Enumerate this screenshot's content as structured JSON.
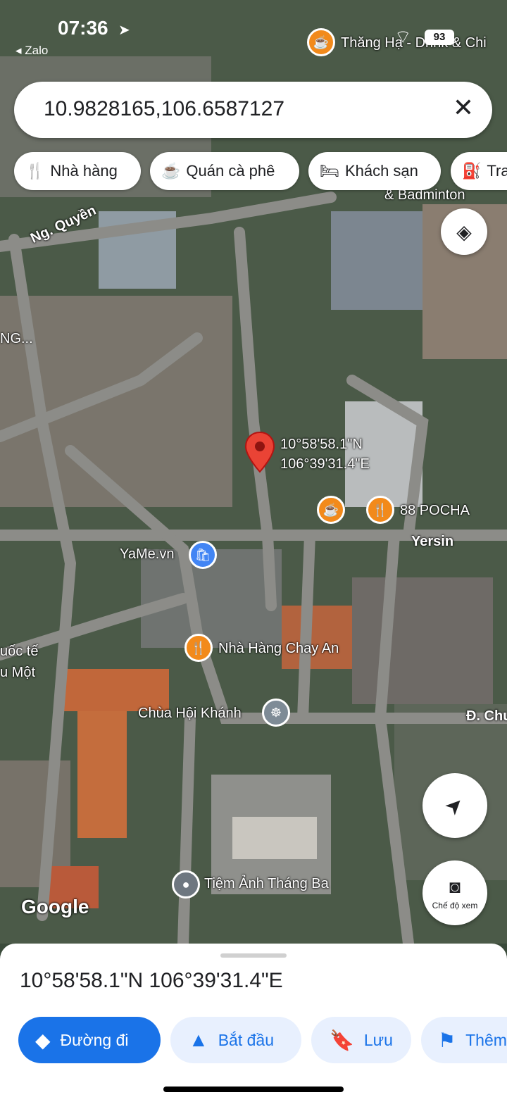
{
  "status_bar": {
    "time": "07:36",
    "back_app": "◂ Zalo",
    "battery": "93"
  },
  "search": {
    "query": "10.9828165,106.6587127"
  },
  "chips": [
    {
      "label": "Nhà hàng",
      "icon": "fork-knife-icon"
    },
    {
      "label": "Quán cà phê",
      "icon": "coffee-cup-icon"
    },
    {
      "label": "Khách sạn",
      "icon": "bed-icon"
    },
    {
      "label": "Tra",
      "icon": "gas-pump-icon"
    }
  ],
  "map": {
    "pin_label_lat": "10°58'58.1\"N",
    "pin_label_lng": "106°39'31.4\"E",
    "places": {
      "thang_ha": "Thăng Hạ - Drink & Chi",
      "badminton": "& Badminton",
      "ng_quyen": "Ng. Quyền",
      "ng_partial": "NG...",
      "pocha": "88 POCHA",
      "yersin": "Yersin",
      "yame": "YaMe.vn",
      "chay_an": "Nhà Hàng Chay An",
      "quoc_te": "uốc tế",
      "mot": "u Một",
      "chua": "Chùa Hội Khánh",
      "d_chu": "Đ. Chu",
      "tiem_anh": "Tiệm Ảnh Tháng Ba",
      "google": "Google"
    },
    "street_view_label": "Chế độ xem"
  },
  "sheet": {
    "coordinates": "10°58'58.1\"N 106°39'31.4\"E",
    "actions": [
      {
        "label": "Đường đi",
        "icon": "directions-icon"
      },
      {
        "label": "Bắt đầu",
        "icon": "navigation-arrow-icon"
      },
      {
        "label": "Lưu",
        "icon": "bookmark-icon"
      },
      {
        "label": "Thêm",
        "icon": "flag-icon"
      }
    ]
  },
  "colors": {
    "accent": "#1a73e8",
    "accent_light": "#e8f0fe",
    "pin": "#ea4335",
    "poi": "#f28a1b"
  }
}
